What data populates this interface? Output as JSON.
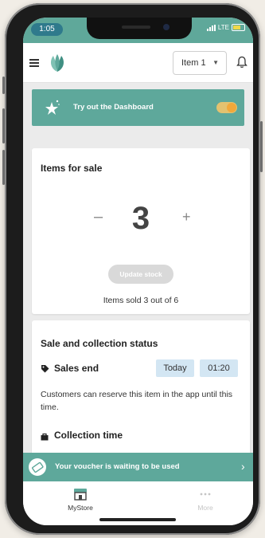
{
  "status_bar": {
    "time": "1:05",
    "network": "LTE"
  },
  "header": {
    "item_selector_value": "Item 1"
  },
  "dashboard_banner": {
    "label": "Try out the Dashboard",
    "toggle_on": true
  },
  "items_card": {
    "title": "Items for sale",
    "minus": "–",
    "quantity": "3",
    "plus": "+",
    "update_button": "Update stock",
    "sold_text": "Items sold 3 out of 6"
  },
  "status_card": {
    "title": "Sale and collection status",
    "sales_end_label": "Sales end",
    "sales_end_day": "Today",
    "sales_end_time": "01:20",
    "reserve_text": "Customers can reserve this item in the app until this time.",
    "collection_label": "Collection time"
  },
  "voucher": {
    "text": "Your voucher is waiting to be used",
    "chevron": "›"
  },
  "bottom_nav": {
    "items": [
      {
        "label": "MyStore",
        "icon": "store-icon",
        "active": true
      },
      {
        "label": "More",
        "icon": "more-dots-icon",
        "active": false
      }
    ]
  },
  "colors": {
    "accent": "#5ea89b",
    "status_bar": "#5fa89a",
    "chip": "#d3e6f3",
    "toggle_knob": "#f2a83a",
    "button_disabled": "#d9d9d9"
  }
}
